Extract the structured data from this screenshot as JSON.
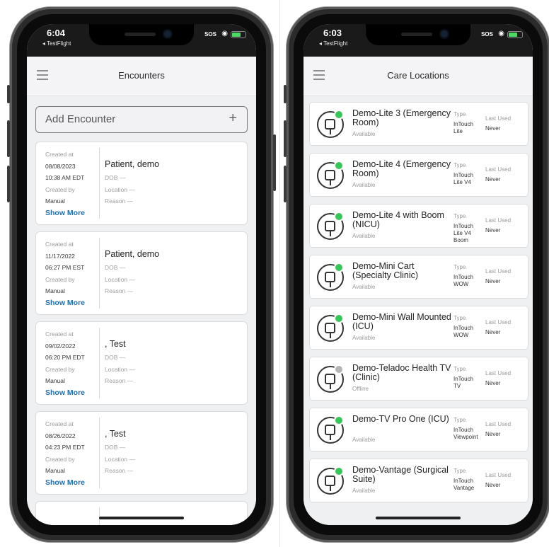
{
  "colors": {
    "available": "#35c759",
    "offline": "#b5b5b5",
    "link": "#1f6fb2"
  },
  "left_phone": {
    "status": {
      "time": "6:04",
      "back": "◂ TestFlight",
      "sos": "SOS"
    },
    "title": "Encounters",
    "add_button": "Add Encounter",
    "encounters": [
      {
        "created_label": "Created at",
        "date": "08/08/2023",
        "time": "10:38 AM EDT",
        "created_by_label": "Created by",
        "created_by": "Manual",
        "show_more": "Show More",
        "name": "Patient, demo",
        "dob": "DOB —",
        "location": "Location —",
        "reason": "Reason —"
      },
      {
        "created_label": "Created at",
        "date": "11/17/2022",
        "time": "06:27 PM EST",
        "created_by_label": "Created by",
        "created_by": "Manual",
        "show_more": "Show More",
        "name": "Patient, demo",
        "dob": "DOB —",
        "location": "Location —",
        "reason": "Reason —"
      },
      {
        "created_label": "Created at",
        "date": "09/02/2022",
        "time": "06:20 PM EDT",
        "created_by_label": "Created by",
        "created_by": "Manual",
        "show_more": "Show More",
        "name": ", Test",
        "dob": "DOB —",
        "location": "Location —",
        "reason": "Reason —"
      },
      {
        "created_label": "Created at",
        "date": "08/26/2022",
        "time": "04:23 PM EDT",
        "created_by_label": "Created by",
        "created_by": "Manual",
        "show_more": "Show More",
        "name": ", Test",
        "dob": "DOB —",
        "location": "Location —",
        "reason": "Reason —"
      }
    ]
  },
  "right_phone": {
    "status": {
      "time": "6:03",
      "back": "◂ TestFlight",
      "sos": "SOS"
    },
    "title": "Care Locations",
    "type_label": "Type",
    "last_used_label": "Last Used",
    "locations": [
      {
        "name": "Demo-Lite 3 (Emergency Room)",
        "status": "Available",
        "type": "InTouch\nLite",
        "last_used": "Never",
        "online": true
      },
      {
        "name": "Demo-Lite 4 (Emergency Room)",
        "status": "Available",
        "type": "InTouch\nLite V4",
        "last_used": "Never",
        "online": true
      },
      {
        "name": "Demo-Lite 4 with Boom (NICU)",
        "status": "Available",
        "type": "InTouch\nLite V4\nBoom",
        "last_used": "Never",
        "online": true
      },
      {
        "name": "Demo-Mini Cart (Specialty Clinic)",
        "status": "Available",
        "type": "InTouch\nWOW",
        "last_used": "Never",
        "online": true
      },
      {
        "name": "Demo-Mini Wall Mounted (ICU)",
        "status": "Available",
        "type": "InTouch\nWOW",
        "last_used": "Never",
        "online": true
      },
      {
        "name": "Demo-Teladoc Health TV (Clinic)",
        "status": "Offline",
        "type": "InTouch\nTV",
        "last_used": "Never",
        "online": false
      },
      {
        "name": "Demo-TV Pro One (ICU)",
        "status": "Available",
        "type": "InTouch\nViewpoint",
        "last_used": "Never",
        "online": true
      },
      {
        "name": "Demo-Vantage (Surgical Suite)",
        "status": "Available",
        "type": "InTouch\nVantage",
        "last_used": "Never",
        "online": true
      }
    ]
  }
}
